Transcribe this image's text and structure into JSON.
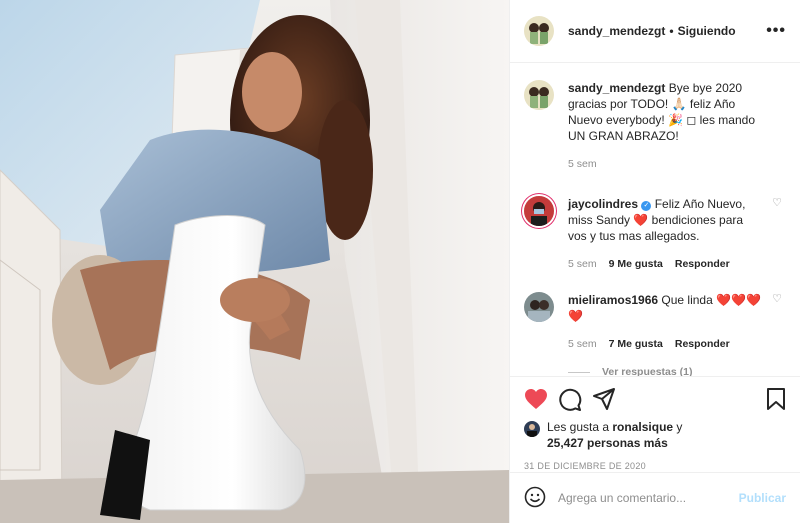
{
  "post": {
    "author": "sandy_mendezgt",
    "separator": "•",
    "follow_status": "Siguiendo",
    "more_icon": "more-options-icon"
  },
  "caption": {
    "username": "sandy_mendezgt",
    "text": "Bye bye 2020 gracias por TODO! 🙏🏻 feliz Año Nuevo everybody! 🎉 ◻ les mando UN GRAN ABRAZO!",
    "time": "5 sem"
  },
  "comments": [
    {
      "username": "jaycolindres",
      "verified": true,
      "text_before": "Feliz Año Nuevo, miss Sandy",
      "emoji": "❤️",
      "text_after": "bendiciones para vos y tus mas allegados.",
      "time": "5 sem",
      "likes": "9 Me gusta",
      "reply": "Responder"
    },
    {
      "username": "mieliramos1966",
      "text_before": "Que linda",
      "emoji": "❤️❤️❤️❤️",
      "time": "5 sem",
      "likes": "7 Me gusta",
      "reply": "Responder",
      "view_replies": "Ver respuestas (1)"
    }
  ],
  "likes_info": {
    "prefix": "Les gusta a",
    "liker": "ronalsique",
    "joiner": "y",
    "count_text": "25,427 personas más"
  },
  "date": "31 DE DICIEMBRE DE 2020",
  "add_comment": {
    "placeholder": "Agrega un comentario...",
    "publish": "Publicar"
  },
  "colors": {
    "like_red": "#ed4956",
    "link_blue": "#3897f0",
    "publish_disabled": "#b2dffc",
    "muted": "#8e8e8e"
  }
}
